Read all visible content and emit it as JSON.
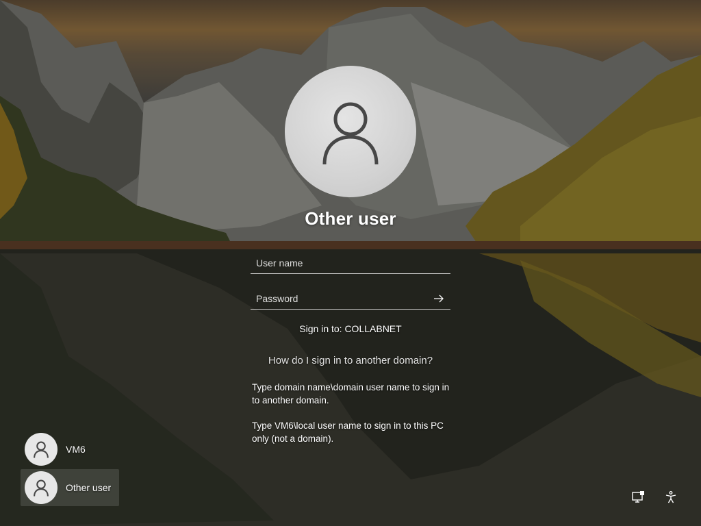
{
  "login": {
    "title": "Other user",
    "username_placeholder": "User name",
    "password_placeholder": "Password",
    "sign_in_to": "Sign in to: COLLABNET",
    "help_link": "How do I sign in to another domain?",
    "help_text_1": "Type domain name\\domain user name to sign in to another domain.",
    "help_text_2": "Type VM6\\local user name to sign in to this PC only (not a domain)."
  },
  "users": [
    {
      "name": "VM6",
      "selected": false
    },
    {
      "name": "Other user",
      "selected": true
    }
  ],
  "icons": {
    "avatar": "person-icon",
    "submit": "arrow-right-icon",
    "network": "network-icon",
    "accessibility": "accessibility-icon"
  },
  "colors": {
    "avatar_bg": "#d6d6d6",
    "avatar_glyph": "#474747",
    "text": "#ffffff"
  }
}
